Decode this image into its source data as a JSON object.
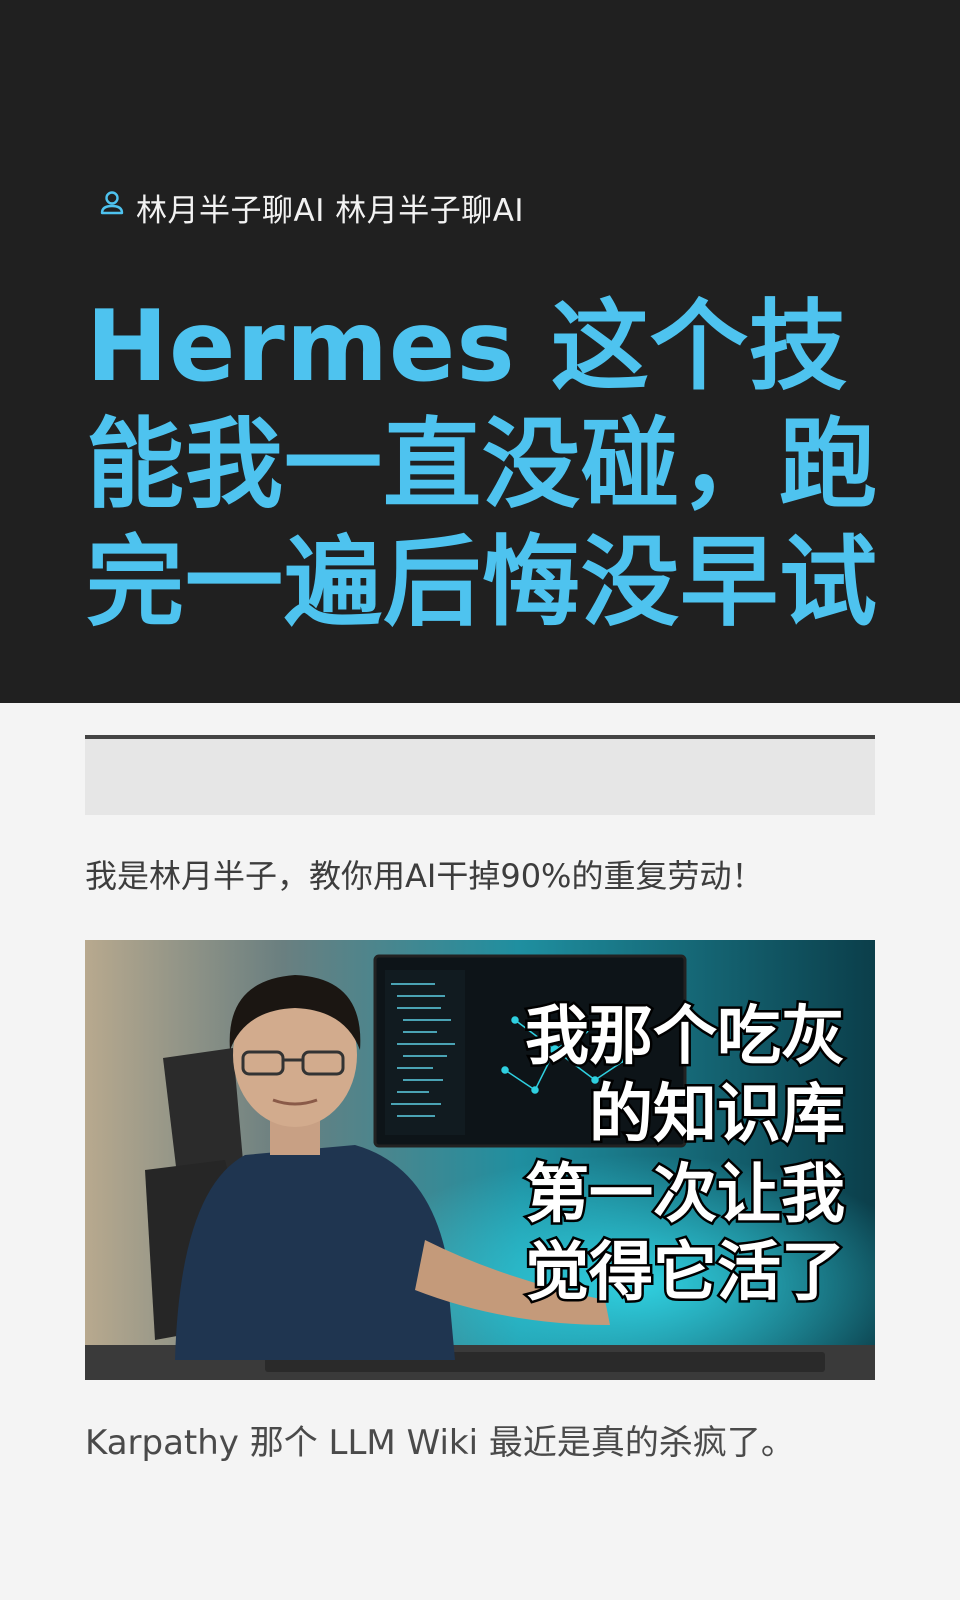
{
  "article": {
    "author": "林月半子聊AI 林月半子聊AI",
    "author_icon": "user-icon",
    "title_lines": [
      "Hermes 这个技",
      "能我一直没碰，跑",
      "完一遍后悔没早试"
    ],
    "intro": "我是林月半子，教你用AI干掉90%的重复劳动！",
    "cover": {
      "overlay_lines": [
        "我那个吃灰",
        "的知识库",
        "第一次让我",
        "觉得它活了"
      ]
    },
    "caption": "Karpathy 那个 LLM Wiki 最近是真的杀疯了。"
  },
  "colors": {
    "hero_bg": "#202020",
    "title": "#4ec3ef",
    "page_bg": "#f4f4f4"
  }
}
